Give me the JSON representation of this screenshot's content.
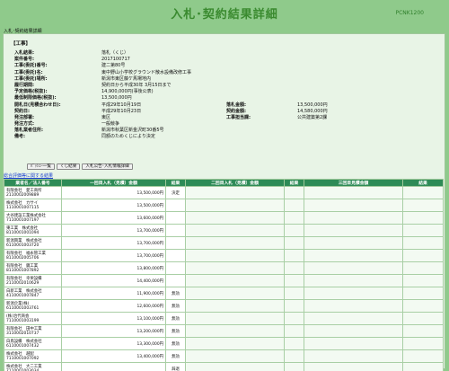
{
  "header": {
    "title": "入札･契約結果詳細",
    "code": "PCNK1200"
  },
  "breadcrumb": "入札･契約結果詳細",
  "section_title": "【工事】",
  "details": [
    {
      "label": "入札結果:",
      "value": "落札（くじ）"
    },
    {
      "label": "案件番号:",
      "value": "2017100717"
    },
    {
      "label": "工事(委託)番号:",
      "value": "建二第80号"
    },
    {
      "label": "工事(委託)名:",
      "value": "東中野山小学校グラウンド散水設備改修工事"
    },
    {
      "label": "工事(委託)場所:",
      "value": "新潟市東区藤ケ馬場地内"
    },
    {
      "label": "履行期間:",
      "value": "契約日から平成30年 3月15日まで"
    },
    {
      "label": "予定価格(税抜):",
      "value": "14,900,000円(事後公表)"
    },
    {
      "label": "最低制限価格(税抜):",
      "value": "13,500,000円"
    },
    {
      "label": "開札日(見積合わせ日):",
      "value": "平成29年10月19日",
      "label2": "落札金額:",
      "value2": "13,500,000円"
    },
    {
      "label": "契約日:",
      "value": "平成29年10月23日",
      "label2": "契約金額:",
      "value2": "14,580,000円"
    },
    {
      "label": "発注部署:",
      "value": "東区",
      "label2": "工事担当課:",
      "value2": "公共建築第2課"
    },
    {
      "label": "発注方式:",
      "value": "一般競争"
    },
    {
      "label": "落札業者住所:",
      "value": "新潟市秋葉区新金沢町30番5号"
    },
    {
      "label": "備考:",
      "value": "同額のためくじにより決定"
    }
  ],
  "buttons": [
    "ﾊﾞｯｼｭｰ一覧",
    "くじ結果",
    "入札公告･入札情報詳細"
  ],
  "link": "総合評価等に関する結果",
  "table": {
    "headers": [
      "業者名／法人番号",
      "一回目入札（見積）金額",
      "結果",
      "二回目入札（見積）金額",
      "結果",
      "三回目見積金額",
      "結果"
    ],
    "rows": [
      {
        "name": "有限会社　愛工商所",
        "num": "2110002009889",
        "amt": "13,500,000円",
        "res": "決定"
      },
      {
        "name": "株式会社　カサイ",
        "num": "1110001007115",
        "amt": "13,500,000円",
        "res": ""
      },
      {
        "name": "大谷建設工業株式会社",
        "num": "7110001007197",
        "amt": "13,600,000円",
        "res": ""
      },
      {
        "name": "東工業　株式会社",
        "num": "8110001001094",
        "amt": "13,700,000円",
        "res": ""
      },
      {
        "name": "新潟興業　株式会社",
        "num": "6110001003720",
        "amt": "13,700,000円",
        "res": ""
      },
      {
        "name": "有限会社　福永管工業",
        "num": "8110002005706",
        "amt": "13,700,000円",
        "res": ""
      },
      {
        "name": "有限会社　鏡工業",
        "num": "8110001007892",
        "amt": "13,800,000円",
        "res": ""
      },
      {
        "name": "有限会社　幸栄設備",
        "num": "2110002010629",
        "amt": "14,400,000円",
        "res": ""
      },
      {
        "name": "白新工業　株式会社",
        "num": "4110001007847",
        "amt": "11,900,000円",
        "res": "無効"
      },
      {
        "name": "新潟企業(株)",
        "num": "6110001003761",
        "amt": "12,600,000円",
        "res": "無効"
      },
      {
        "name": "(株)治代商会",
        "num": "7110001003199",
        "amt": "13,100,000円",
        "res": "無効"
      },
      {
        "name": "有限会社　田中工業",
        "num": "3110002010737",
        "amt": "13,200,000円",
        "res": "無効"
      },
      {
        "name": "白鳥設備　株式会社",
        "num": "6110001007432",
        "amt": "13,300,000円",
        "res": "無効"
      },
      {
        "name": "株式会社　越配",
        "num": "7110001007092",
        "amt": "13,400,000円",
        "res": "無効"
      },
      {
        "name": "株式会社　大二工業",
        "num": "7110001003034",
        "amt": "",
        "res": "辞退"
      }
    ]
  }
}
